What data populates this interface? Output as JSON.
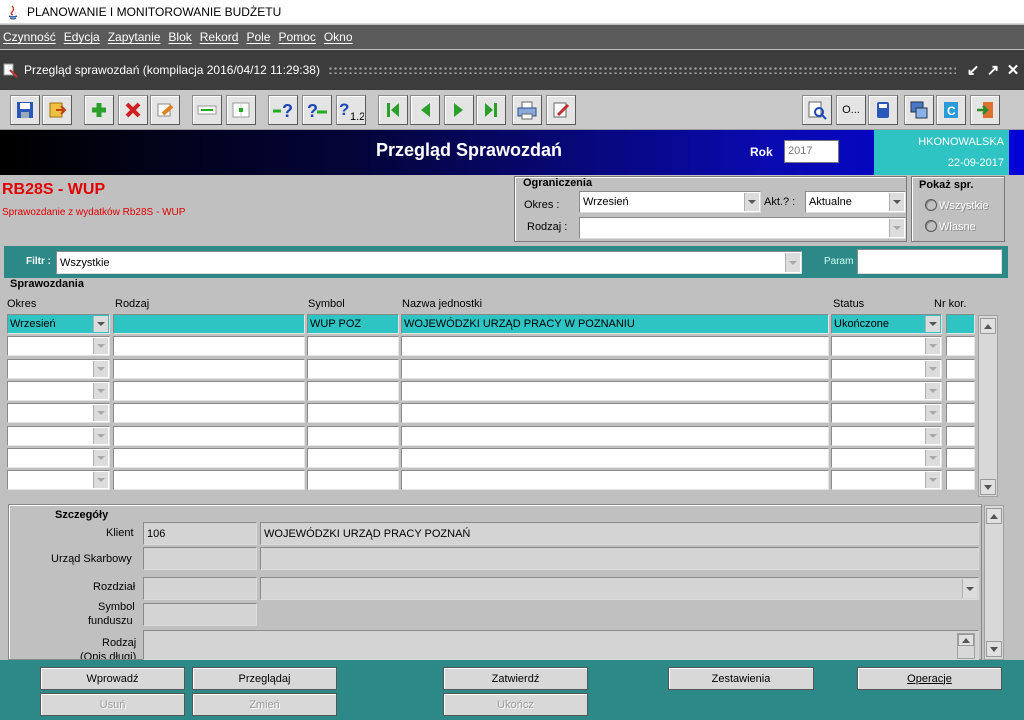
{
  "app": {
    "title": "PLANOWANIE I MONITOROWANIE BUDŻETU"
  },
  "menu": [
    "Czynność",
    "Edycja",
    "Zapytanie",
    "Blok",
    "Rekord",
    "Pole",
    "Pomoc",
    "Okno"
  ],
  "window": {
    "title": "Przegląd sprawozdań (kompilacja 2016/04/12 11:29:38)",
    "controls": [
      "↙",
      "↗",
      "✕"
    ]
  },
  "toolbar": {
    "left_icons": [
      "save-icon",
      "exit-icon",
      "add-record-icon",
      "delete-record-icon",
      "clear-record-icon",
      "duplicate-icon",
      "blank-icon",
      "enter-query-icon",
      "execute-query-icon",
      "count-query-icon",
      "first-record-icon",
      "previous-record-icon",
      "next-record-icon",
      "last-record-icon",
      "print-icon",
      "edit-icon"
    ],
    "right_icons": [
      "preview-icon",
      "more-icon",
      "calculator-icon",
      "windows-icon",
      "copy-icon",
      "logout-icon"
    ],
    "more_label": "O..."
  },
  "header": {
    "title": "Przegląd Sprawozdań",
    "rok_label": "Rok",
    "rok_value": "2017",
    "user": "HKONOWALSKA",
    "date": "22-09-2017",
    "accent_color": "#2fc4c4"
  },
  "form": {
    "title": "RB28S - WUP",
    "subtitle": "Sprawozdanie z wydatków Rb28S - WUP",
    "title_color": "#e00000"
  },
  "ograniczenia": {
    "title": "Ograniczenia",
    "okres_label": "Okres :",
    "okres_value": "Wrzesień",
    "akt_label": "Akt.? :",
    "akt_value": "Aktualne",
    "rodzaj_label": "Rodzaj :",
    "rodzaj_value": ""
  },
  "pokaz": {
    "title": "Pokaż spr.",
    "options": [
      "Wszystkie",
      "Własne"
    ]
  },
  "filter": {
    "label": "Filtr :",
    "value": "Wszystkie",
    "param_label": "Param",
    "param_value": ""
  },
  "table": {
    "section_label": "Sprawozdania",
    "headers": {
      "okres": "Okres",
      "rodzaj": "Rodzaj",
      "symbol": "Symbol",
      "nazwa": "Nazwa jednostki",
      "status": "Status",
      "nr": "Nr kor."
    },
    "rows": [
      {
        "okres": "Wrzesień",
        "rodzaj": "",
        "symbol": "WUP POZ",
        "nazwa": "WOJEWÓDZKI URZĄD PRACY W POZNANIU",
        "status": "Ukończone",
        "nr": ""
      },
      {
        "okres": "",
        "rodzaj": "",
        "symbol": "",
        "nazwa": "",
        "status": "",
        "nr": ""
      },
      {
        "okres": "",
        "rodzaj": "",
        "symbol": "",
        "nazwa": "",
        "status": "",
        "nr": ""
      },
      {
        "okres": "",
        "rodzaj": "",
        "symbol": "",
        "nazwa": "",
        "status": "",
        "nr": ""
      },
      {
        "okres": "",
        "rodzaj": "",
        "symbol": "",
        "nazwa": "",
        "status": "",
        "nr": ""
      },
      {
        "okres": "",
        "rodzaj": "",
        "symbol": "",
        "nazwa": "",
        "status": "",
        "nr": ""
      },
      {
        "okres": "",
        "rodzaj": "",
        "symbol": "",
        "nazwa": "",
        "status": "",
        "nr": ""
      },
      {
        "okres": "",
        "rodzaj": "",
        "symbol": "",
        "nazwa": "",
        "status": "",
        "nr": ""
      }
    ]
  },
  "szczegoly": {
    "title": "Szczegóły",
    "klient_label": "Klient",
    "klient_code": "106",
    "klient_name": "WOJEWÓDZKI URZĄD PRACY POZNAŃ",
    "urzad_label": "Urząd Skarbowy",
    "urzad_code": "",
    "urzad_name": "",
    "rozdzial_label": "Rozdział",
    "rozdzial_code": "",
    "rozdzial_name": "",
    "symbol_label_1": "Symbol",
    "symbol_label_2": "funduszu",
    "symbol_value": "",
    "rodzaj_label_1": "Rodzaj",
    "rodzaj_label_2": "(Opis długi)",
    "rodzaj_value": ""
  },
  "buttons": {
    "wprowadz": "Wprowadź",
    "przegladaj": "Przeglądaj",
    "zatwierdz": "Zatwierdź",
    "zestawienia": "Zestawienia",
    "operacje": "Operacje",
    "usun": "Usuń",
    "zmien": "Zmień",
    "ukoncz": "Ukończ"
  }
}
